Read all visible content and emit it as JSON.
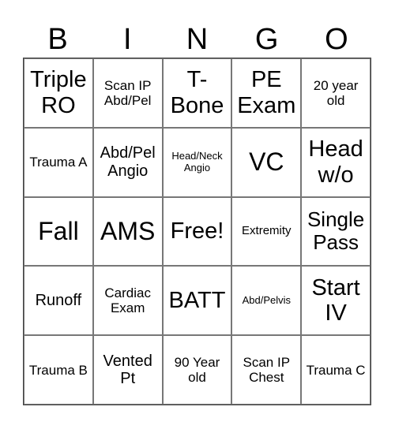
{
  "header": [
    "B",
    "I",
    "N",
    "G",
    "O"
  ],
  "cells": [
    {
      "text": "Triple RO",
      "size": "s-l"
    },
    {
      "text": "Scan IP Abd/Pel",
      "size": "s-s"
    },
    {
      "text": "T- Bone",
      "size": "s-l"
    },
    {
      "text": "PE Exam",
      "size": "s-l"
    },
    {
      "text": "20 year old",
      "size": "s-s"
    },
    {
      "text": "Trauma A",
      "size": "s-s"
    },
    {
      "text": "Abd/Pel Angio",
      "size": "s-m"
    },
    {
      "text": "Head/Neck Angio",
      "size": "s-xs"
    },
    {
      "text": "VC",
      "size": "s-xl"
    },
    {
      "text": "Head w/o",
      "size": "s-l"
    },
    {
      "text": "Fall",
      "size": "s-xl"
    },
    {
      "text": "AMS",
      "size": "s-xl"
    },
    {
      "text": "Free!",
      "size": "s-l"
    },
    {
      "text": "Extremity",
      "size": "s-xxs"
    },
    {
      "text": "Single Pass",
      "size": "s-mid"
    },
    {
      "text": "Runoff",
      "size": "s-m"
    },
    {
      "text": "Cardiac Exam",
      "size": "s-s"
    },
    {
      "text": "BATT",
      "size": "s-l"
    },
    {
      "text": "Abd/Pelvis",
      "size": "s-xs"
    },
    {
      "text": "Start IV",
      "size": "s-l"
    },
    {
      "text": "Trauma B",
      "size": "s-s"
    },
    {
      "text": "Vented Pt",
      "size": "s-m"
    },
    {
      "text": "90 Year old",
      "size": "s-s"
    },
    {
      "text": "Scan IP Chest",
      "size": "s-s"
    },
    {
      "text": "Trauma C",
      "size": "s-s"
    }
  ]
}
